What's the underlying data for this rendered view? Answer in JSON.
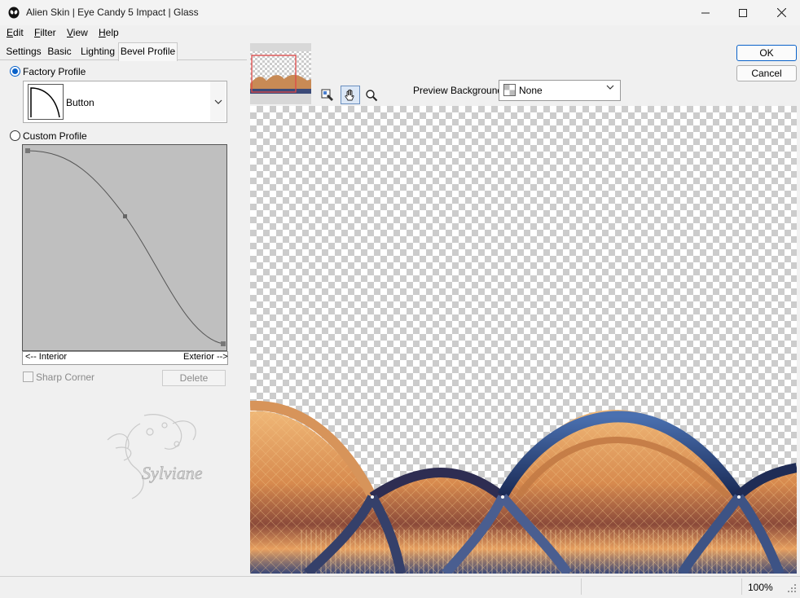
{
  "window": {
    "title": "Alien Skin | Eye Candy 5 Impact | Glass",
    "minimize_icon": "minimize-icon",
    "maximize_icon": "maximize-icon",
    "close_icon": "close-icon"
  },
  "menu": [
    "Edit",
    "Filter",
    "View",
    "Help"
  ],
  "tabs": [
    "Settings",
    "Basic",
    "Lighting",
    "Bevel Profile"
  ],
  "active_tab": "Bevel Profile",
  "bevel": {
    "factory_label": "Factory Profile",
    "factory_selected": true,
    "profile_value": "Button",
    "custom_label": "Custom Profile",
    "interior_label": "<-- Interior",
    "exterior_label": "Exterior -->",
    "sharp_corner_label": "Sharp Corner",
    "delete_label": "Delete"
  },
  "watermark_text": "Sylviane",
  "preview": {
    "background_label": "Preview Background:",
    "background_value": "None"
  },
  "buttons": {
    "ok": "OK",
    "cancel": "Cancel"
  },
  "status": {
    "zoom": "100%"
  },
  "colors": {
    "accent": "#0a62c9",
    "curve_bg": "#bfbfbf"
  }
}
